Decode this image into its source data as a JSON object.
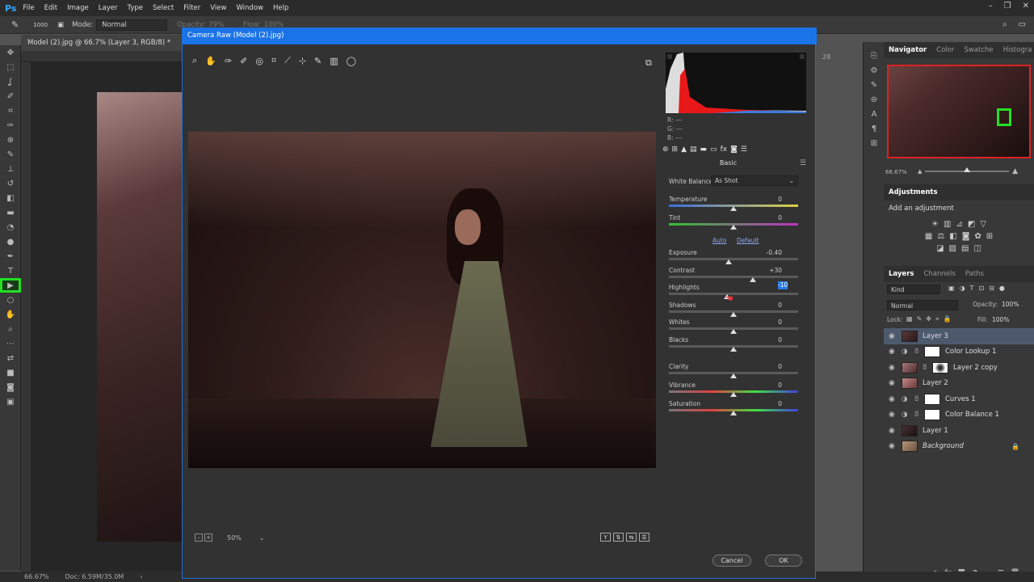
{
  "menubar": {
    "logo": "Ps",
    "items": [
      "File",
      "Edit",
      "Image",
      "Layer",
      "Type",
      "Select",
      "Filter",
      "View",
      "Window",
      "Help"
    ]
  },
  "options": {
    "brush_size": "1000",
    "mode_label": "Mode:",
    "mode_value": "Normal",
    "opacity_label": "Opacity:",
    "opacity_value": "79%",
    "flow_label": "Flow:",
    "flow_value": "100%"
  },
  "document": {
    "tab": "Model (2).jpg @ 66.7% (Layer 3, RGB/8) *",
    "zoom": "66.67%",
    "doc_size": "Doc: 6.59M/35.0M",
    "ruler_right": "28"
  },
  "dialog": {
    "title": "Camera Raw (Model (2).jpg)",
    "rgb": [
      "R:  ---",
      "G:  ---",
      "B:  ---"
    ],
    "panel_title": "Basic",
    "white_balance_label": "White Balance:",
    "white_balance_value": "As Shot",
    "auto": "Auto",
    "default": "Default",
    "zoom_label": "50%",
    "cancel": "Cancel",
    "ok": "OK",
    "sliders": [
      {
        "label": "Temperature",
        "value": "0",
        "pos": 0.5
      },
      {
        "label": "Tint",
        "value": "0",
        "pos": 0.5
      },
      {
        "label": "Exposure",
        "value": "-0.40",
        "pos": 0.46
      },
      {
        "label": "Contrast",
        "value": "+30",
        "pos": 0.65
      },
      {
        "label": "Highlights",
        "value": "-10",
        "pos": 0.45
      },
      {
        "label": "Shadows",
        "value": "0",
        "pos": 0.5
      },
      {
        "label": "Whites",
        "value": "0",
        "pos": 0.5
      },
      {
        "label": "Blacks",
        "value": "0",
        "pos": 0.5
      },
      {
        "label": "Clarity",
        "value": "0",
        "pos": 0.5
      },
      {
        "label": "Vibrance",
        "value": "0",
        "pos": 0.5
      },
      {
        "label": "Saturation",
        "value": "0",
        "pos": 0.5
      }
    ]
  },
  "navigator": {
    "tabs": [
      "Navigator",
      "Color",
      "Swatche",
      "Histogra"
    ],
    "zoom": "66.67%"
  },
  "adjustments": {
    "title": "Adjustments",
    "hint": "Add an adjustment"
  },
  "layers_panel": {
    "tabs": [
      "Layers",
      "Channels",
      "Paths"
    ],
    "kind": "Kind",
    "blend": "Normal",
    "opacity_label": "Opacity:",
    "opacity_value": "100%",
    "lock_label": "Lock:",
    "fill_label": "Fill:",
    "fill_value": "100%",
    "layers": [
      {
        "name": "Layer 3",
        "selected": true,
        "type": "photo"
      },
      {
        "name": "Color Lookup 1",
        "selected": false,
        "type": "adj"
      },
      {
        "name": "Layer 2 copy",
        "selected": false,
        "type": "photo-mask"
      },
      {
        "name": "Layer 2",
        "selected": false,
        "type": "photo"
      },
      {
        "name": "Curves 1",
        "selected": false,
        "type": "adj"
      },
      {
        "name": "Color Balance 1",
        "selected": false,
        "type": "adj"
      },
      {
        "name": "Layer 1",
        "selected": false,
        "type": "photo"
      },
      {
        "name": "Background",
        "selected": false,
        "type": "bg"
      }
    ]
  }
}
